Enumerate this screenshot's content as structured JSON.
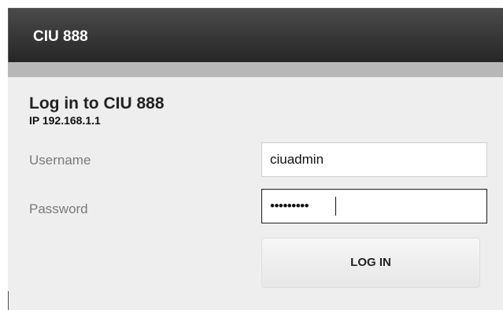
{
  "header": {
    "title": "CIU 888"
  },
  "login": {
    "title": "Log in to CIU 888",
    "ip_text": "IP 192.168.1.1",
    "username_label": "Username",
    "username_value": "ciuadmin",
    "password_label": "Password",
    "password_value": "ciuadmin1",
    "button_label": "LOG IN"
  }
}
